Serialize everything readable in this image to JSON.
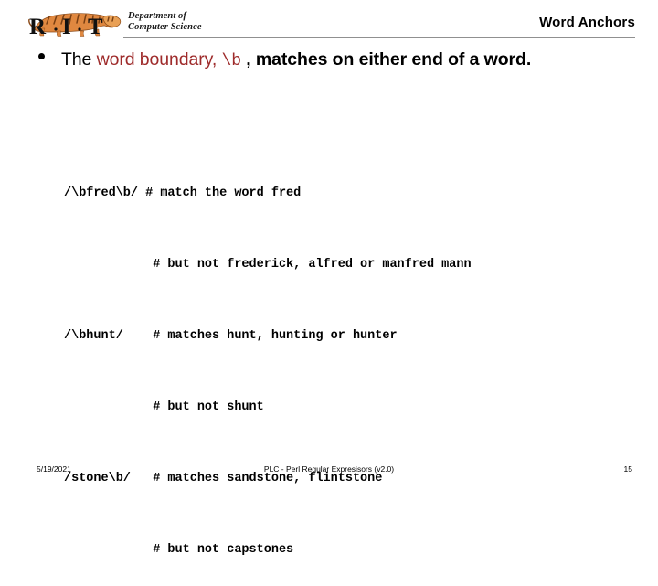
{
  "header": {
    "logo": {
      "mark_text": "R·I·T",
      "icon_name": "rit-tiger-logo",
      "tiger_color": "#E08840",
      "stripe_color": "#8a4a18"
    },
    "department_line1": "Department of",
    "department_line2": "Computer Science",
    "title": "Word Anchors"
  },
  "bullet": {
    "marker": "•",
    "part1": "The ",
    "accent1": "word boundary",
    "part2": ", ",
    "accent_code": "\\b",
    "part3": " , ",
    "part4": "matches on either end of a word.",
    "accent_color": "#9e2b2b"
  },
  "code": {
    "lines": [
      "/\\bfred\\b/ # match the word fred",
      "            # but not frederick, alfred or manfred mann",
      "/\\bhunt/    # matches hunt, hunting or hunter",
      "            # but not shunt",
      "/stone\\b/   # matches sandstone, flintstone",
      "            # but not capstones"
    ]
  },
  "footer": {
    "date": "5/19/2021",
    "center": "PLC - Perl Regular Expresisors  (v2.0)",
    "page_number": "15"
  }
}
